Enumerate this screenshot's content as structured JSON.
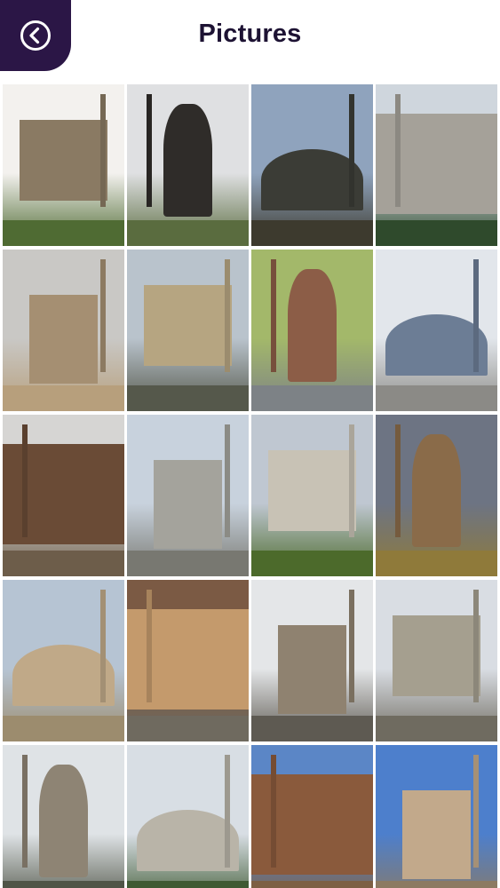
{
  "header": {
    "title": "Pictures",
    "back_icon": "chevron-left-circle-icon",
    "accent_color": "#2b1646"
  },
  "gallery": {
    "photos": [
      {
        "subject": "stone-house-garden",
        "sky": "#f3f1ee",
        "ground": "#4f6b33",
        "main": "#8a7a63"
      },
      {
        "subject": "statue-monument",
        "sky": "#dfe0e2",
        "ground": "#5a6c3f",
        "main": "#2f2c29"
      },
      {
        "subject": "mosque-minarets-cloudy",
        "sky": "#8fa3bd",
        "ground": "#3d3a2e",
        "main": "#3b3c36"
      },
      {
        "subject": "ornate-mosque-facade",
        "sky": "#cfd6dd",
        "ground": "#2f4a2c",
        "main": "#a5a199"
      },
      {
        "subject": "clock-tower-trees",
        "sky": "#c9c8c5",
        "ground": "#b79f7c",
        "main": "#a58f72"
      },
      {
        "subject": "stone-bridge-river",
        "sky": "#b9c3cc",
        "ground": "#55584b",
        "main": "#b6a581"
      },
      {
        "subject": "arcade-courtyard",
        "sky": "#a3b86a",
        "ground": "#7d8286",
        "main": "#8c5d47"
      },
      {
        "subject": "street-buildings",
        "sky": "#e2e6eb",
        "ground": "#8b8a86",
        "main": "#6c7d95"
      },
      {
        "subject": "bronze-fountain",
        "sky": "#d6d5d3",
        "ground": "#6d5d4a",
        "main": "#6a4b36"
      },
      {
        "subject": "twin-minarets-dome",
        "sky": "#c8d2dd",
        "ground": "#787871",
        "main": "#a4a39c"
      },
      {
        "subject": "distant-minarets-view",
        "sky": "#bfc7d1",
        "ground": "#4c6a2b",
        "main": "#c8c2b5"
      },
      {
        "subject": "ruined-wall-sunset",
        "sky": "#6d7483",
        "ground": "#8f7a3a",
        "main": "#8a6b49"
      },
      {
        "subject": "building-scaffolding",
        "sky": "#b6c4d3",
        "ground": "#9c8c6e",
        "main": "#c0a988"
      },
      {
        "subject": "covered-bazaar",
        "sky": "#7b5a44",
        "ground": "#6f6a5f",
        "main": "#c49a6c"
      },
      {
        "subject": "mosque-gate-flag",
        "sky": "#e4e6e8",
        "ground": "#5e5a52",
        "main": "#8f8270"
      },
      {
        "subject": "stone-tower",
        "sky": "#d9dde3",
        "ground": "#6f6b60",
        "main": "#a59f8f"
      },
      {
        "subject": "arched-bridge",
        "sky": "#dfe3e6",
        "ground": "#4f5446",
        "main": "#8e8474"
      },
      {
        "subject": "mosque-courtyard-facade",
        "sky": "#d8dee4",
        "ground": "#3f5a33",
        "main": "#b9b4a8"
      },
      {
        "subject": "dome-minaret-blue-sky",
        "sky": "#5b86c6",
        "ground": "#7d5f43",
        "main": "#8a5a3c"
      },
      {
        "subject": "arcade-domes-column",
        "sky": "#4d7fcc",
        "ground": "#8c7a62",
        "main": "#c2a98b"
      }
    ]
  }
}
